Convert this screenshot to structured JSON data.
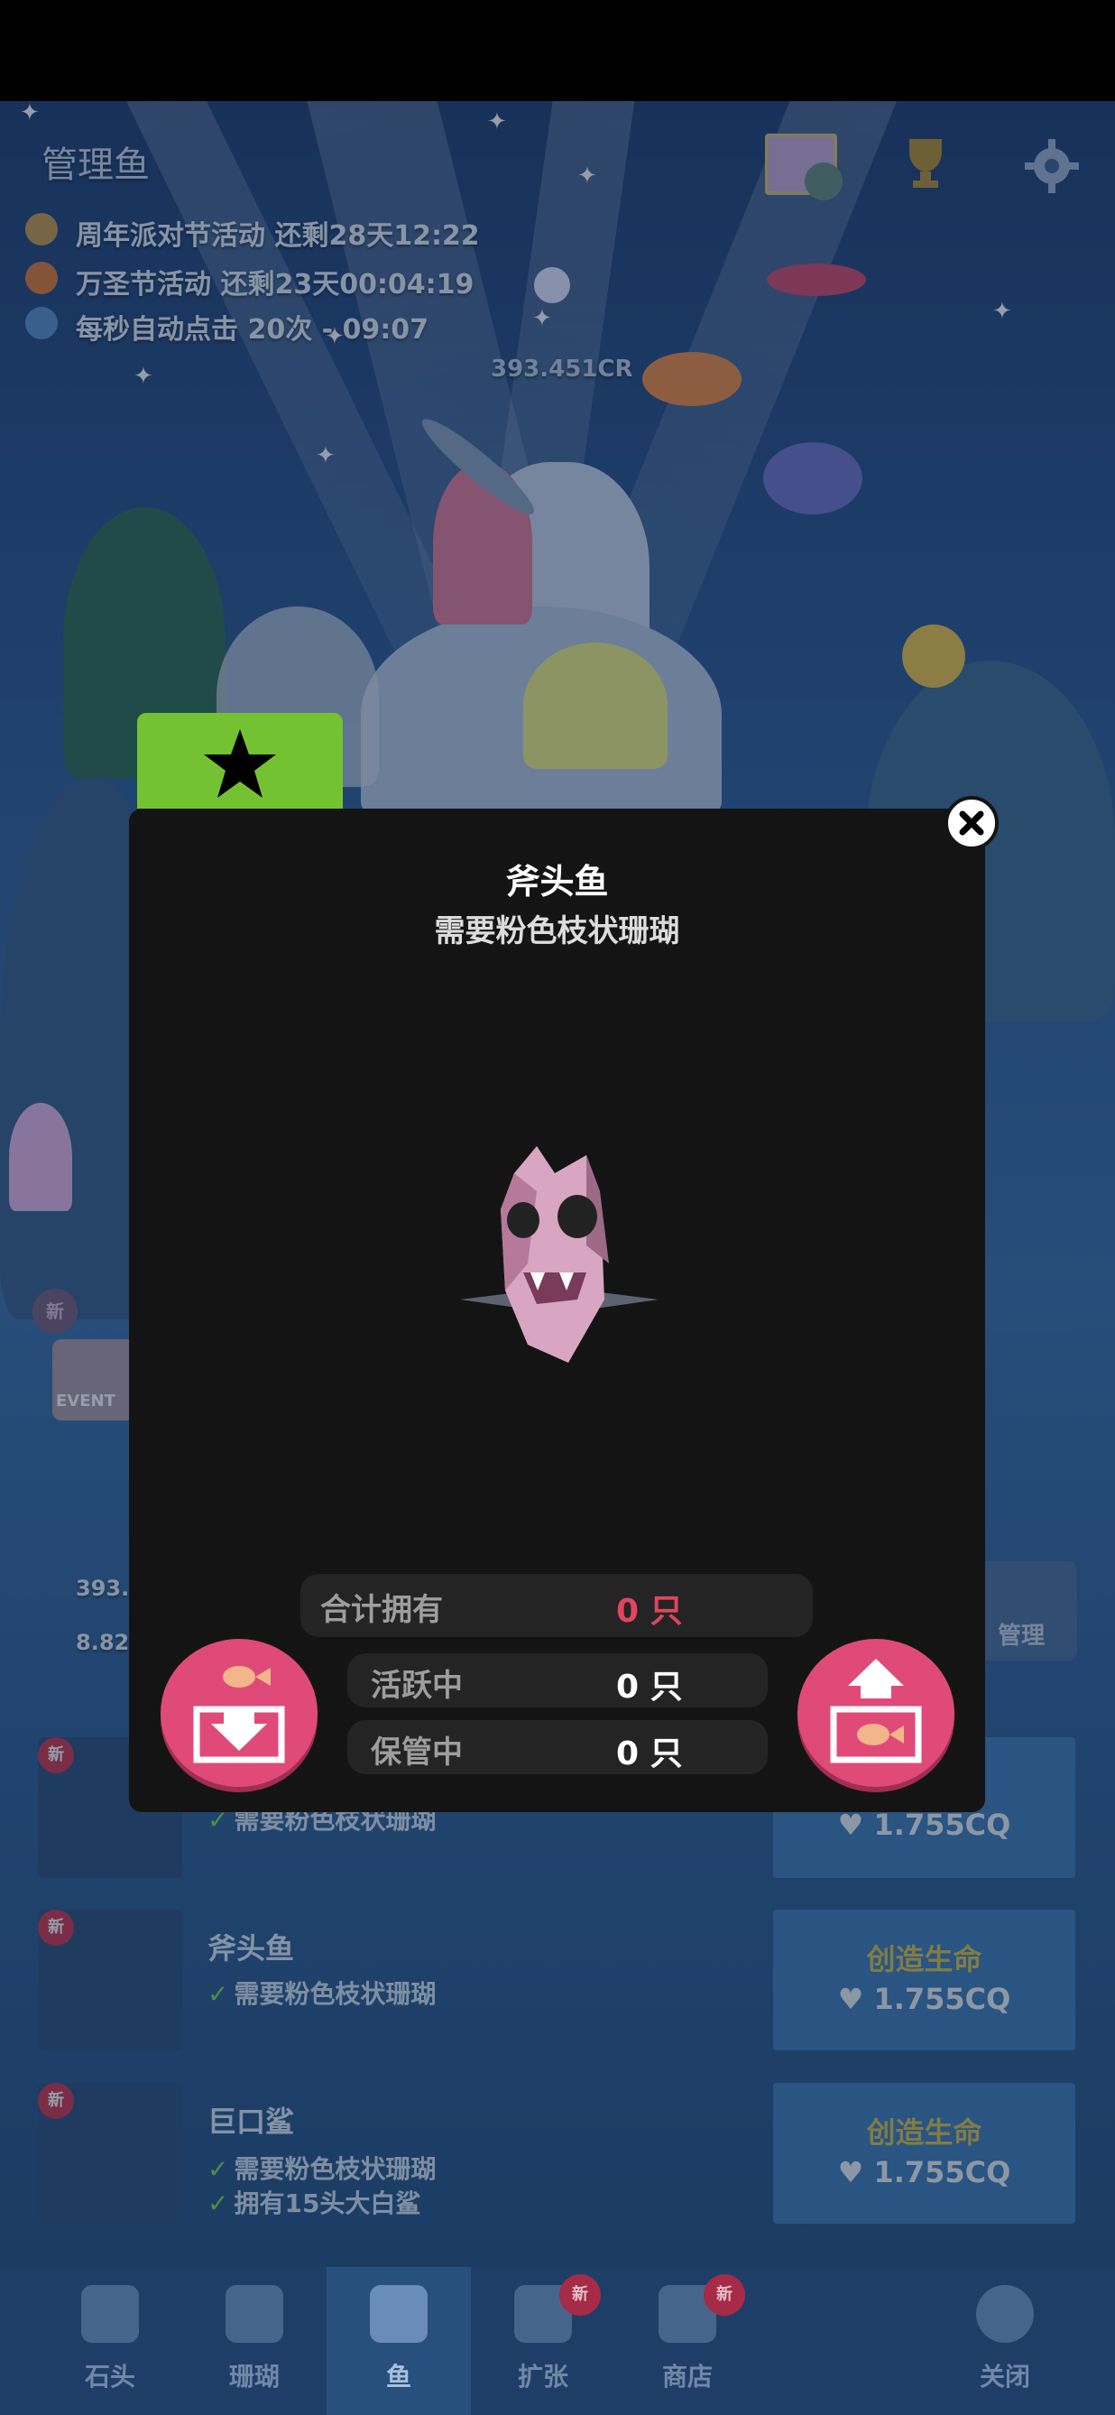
{
  "hud": {
    "title": "管理鱼",
    "events": [
      {
        "icon": "party-icon",
        "text": "周年派对节活动 还剩28天12:22"
      },
      {
        "icon": "pumpkin-icon",
        "text": "万圣节活动 还剩23天00:04:19"
      },
      {
        "icon": "globe-icon",
        "text": "每秒自动点击 20次 - 09:07"
      }
    ],
    "center_value": "393.451CR",
    "left_values": [
      "393.",
      "8.82"
    ],
    "manage_label": "管理",
    "event_badge": "EVENT",
    "new_badge": "新"
  },
  "list": [
    {
      "name": "",
      "requirements": [
        "需要粉色枝状珊瑚"
      ],
      "create_label": "",
      "cost": "1.755CQ",
      "badge": "新"
    },
    {
      "name": "斧头鱼",
      "requirements": [
        "需要粉色枝状珊瑚"
      ],
      "create_label": "创造生命",
      "cost": "1.755CQ",
      "badge": "新"
    },
    {
      "name": "巨口鲨",
      "requirements": [
        "需要粉色枝状珊瑚",
        "拥有15头大白鲨"
      ],
      "create_label": "创造生命",
      "cost": "1.755CQ",
      "badge": "新"
    }
  ],
  "nav": [
    {
      "label": "石头",
      "icon": "rock-icon"
    },
    {
      "label": "珊瑚",
      "icon": "coral-icon"
    },
    {
      "label": "鱼",
      "icon": "fish-icon"
    },
    {
      "label": "扩张",
      "icon": "expand-icon"
    },
    {
      "label": "商店",
      "icon": "shop-icon"
    },
    {
      "label": "关闭",
      "icon": "close-down-icon"
    }
  ],
  "modal": {
    "fish_name": "斧头鱼",
    "requirement": "需要粉色枝状珊瑚",
    "total_label": "合计拥有",
    "total_value": "0 只",
    "active_label": "活跃中",
    "active_value": "0 只",
    "stored_label": "保管中",
    "stored_value": "0 只"
  },
  "colors": {
    "accent_green": "#74c232",
    "button_pink": "#e04a78",
    "total_value_red": "#e0455f",
    "modal_bg": "#141414"
  }
}
